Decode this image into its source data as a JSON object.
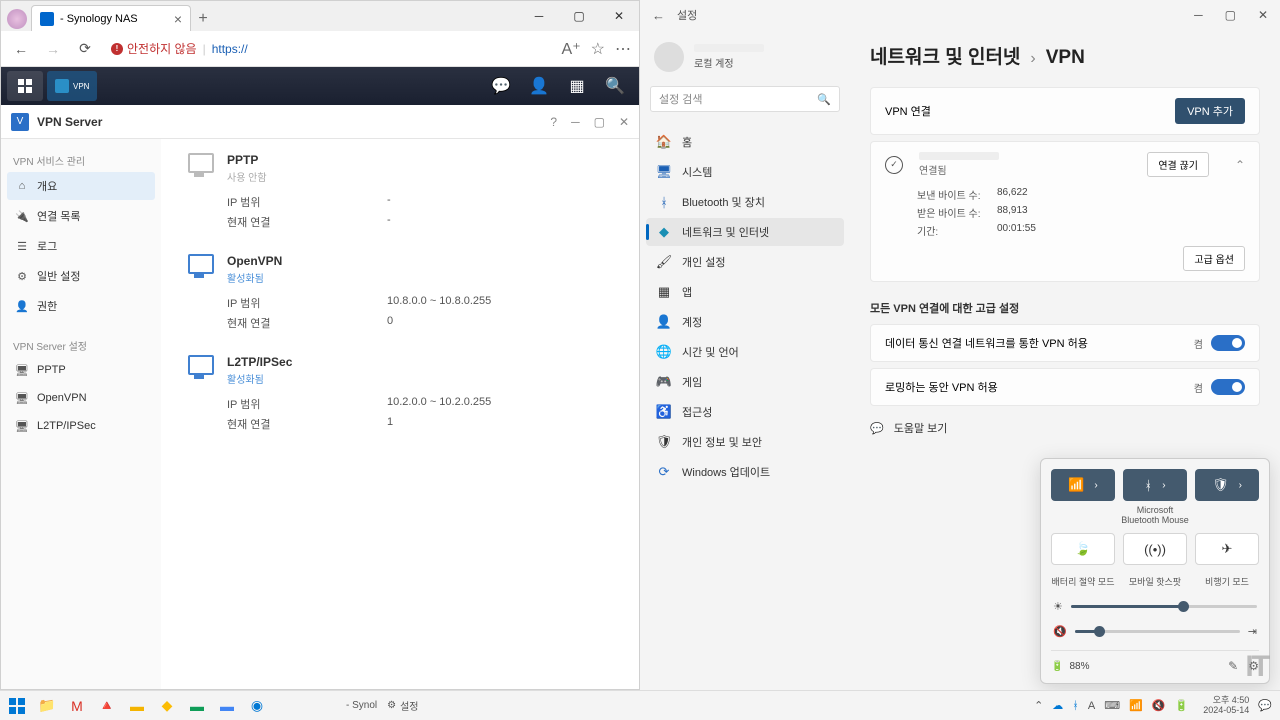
{
  "browser": {
    "tab_title": "- Synology NAS",
    "url_warning": "안전하지 않음",
    "url_scheme": "https://",
    "dsm_task": "VPN"
  },
  "vpn": {
    "title": "VPN Server",
    "side": {
      "group1": "VPN 서비스 관리",
      "items1": [
        "개요",
        "연결 목록",
        "로그",
        "일반 설정",
        "권한"
      ],
      "group2": "VPN Server 설정",
      "items2": [
        "PPTP",
        "OpenVPN",
        "L2TP/IPSec"
      ]
    },
    "protocols": [
      {
        "name": "PPTP",
        "status": "사용 안함",
        "enabled": false,
        "ip_label": "IP 범위",
        "ip": "-",
        "conn_label": "현재 연결",
        "conn": "-"
      },
      {
        "name": "OpenVPN",
        "status": "활성화됨",
        "enabled": true,
        "ip_label": "IP 범위",
        "ip": "10.8.0.0 ~ 10.8.0.255",
        "conn_label": "현재 연결",
        "conn": "0"
      },
      {
        "name": "L2TP/IPSec",
        "status": "활성화됨",
        "enabled": true,
        "ip_label": "IP 범위",
        "ip": "10.2.0.0 ~ 10.2.0.255",
        "conn_label": "현재 연결",
        "conn": "1"
      }
    ]
  },
  "settings": {
    "title": "설정",
    "user_label": "로컬 계정",
    "search_placeholder": "설정 검색",
    "nav": [
      "홈",
      "시스템",
      "Bluetooth 및 장치",
      "네트워크 및 인터넷",
      "개인 설정",
      "앱",
      "계정",
      "시간 및 언어",
      "게임",
      "접근성",
      "개인 정보 및 보안",
      "Windows 업데이트"
    ],
    "breadcrumb_root": "네트워크 및 인터넷",
    "breadcrumb_leaf": "VPN",
    "conn_heading": "VPN 연결",
    "add_btn": "VPN 추가",
    "conn_name": "",
    "conn_status": "연결됨",
    "disconnect": "연결 끊기",
    "stats": {
      "sent_label": "보낸 바이트 수:",
      "sent": "86,622",
      "recv_label": "받은 바이트 수:",
      "recv": "88,913",
      "dur_label": "기간:",
      "dur": "00:01:55"
    },
    "adv_btn": "고급 옵션",
    "adv_heading": "모든 VPN 연결에 대한 고급 설정",
    "rows": [
      {
        "label": "데이터 통신 연결 네트워크를 통한 VPN 허용",
        "state": "켬"
      },
      {
        "label": "로밍하는 동안 VPN 허용",
        "state": "켬"
      }
    ],
    "help": "도움말 보기"
  },
  "qs": {
    "bt_device_line1": "Microsoft",
    "bt_device_line2": "Bluetooth Mouse",
    "labels": [
      "배터리 절약 모드",
      "모바일 핫스팟",
      "비행기 모드"
    ],
    "battery": "88%",
    "brightness": 60,
    "volume": 15
  },
  "taskbar": {
    "task1": "- Synol",
    "task2": "설정",
    "clock_time": "오후 4:50",
    "clock_date": "2024-05-14"
  }
}
